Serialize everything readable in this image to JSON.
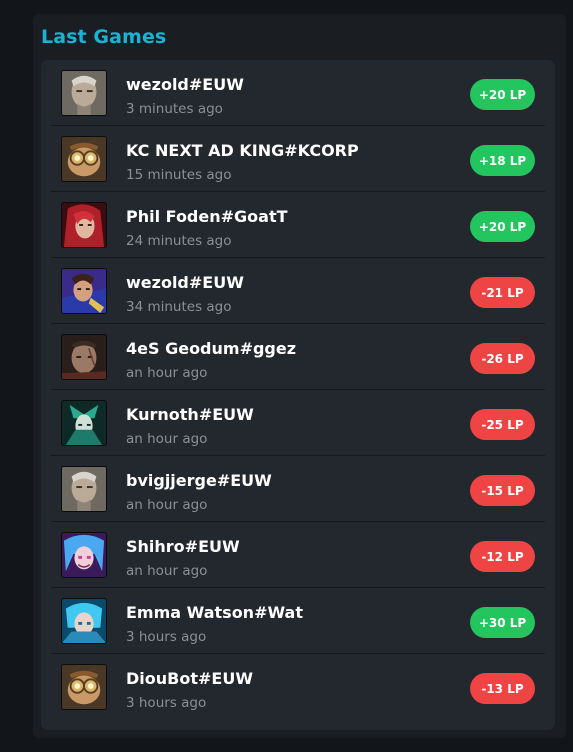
{
  "panel": {
    "title": "Last Games"
  },
  "colors": {
    "title": "#19b3d3",
    "win_badge": "#22c55e",
    "loss_badge": "#ef4444"
  },
  "games": [
    {
      "player": "wezold#EUW",
      "time": "3 minutes ago",
      "lp": "+20 LP",
      "result": "win",
      "champion_icon": "elder-warrior-portrait-icon"
    },
    {
      "player": "KC NEXT AD KING#KCORP",
      "time": "15 minutes ago",
      "lp": "+18 LP",
      "result": "win",
      "champion_icon": "goggled-yordle-portrait-icon"
    },
    {
      "player": "Phil Foden#GoatT",
      "time": "24 minutes ago",
      "lp": "+20 LP",
      "result": "win",
      "champion_icon": "red-haired-champion-portrait-icon"
    },
    {
      "player": "wezold#EUW",
      "time": "34 minutes ago",
      "lp": "-21 LP",
      "result": "loss",
      "champion_icon": "blue-armored-champion-portrait-icon"
    },
    {
      "player": "4eS Geodum#ggez",
      "time": "an hour ago",
      "lp": "-26 LP",
      "result": "loss",
      "champion_icon": "scarred-champion-portrait-icon"
    },
    {
      "player": "Kurnoth#EUW",
      "time": "an hour ago",
      "lp": "-25 LP",
      "result": "loss",
      "champion_icon": "green-sorceress-portrait-icon"
    },
    {
      "player": "bvigjjerge#EUW",
      "time": "an hour ago",
      "lp": "-15 LP",
      "result": "loss",
      "champion_icon": "elder-warrior-portrait-icon"
    },
    {
      "player": "Shihro#EUW",
      "time": "an hour ago",
      "lp": "-12 LP",
      "result": "loss",
      "champion_icon": "blue-haired-champion-portrait-icon"
    },
    {
      "player": "Emma Watson#Wat",
      "time": "3 hours ago",
      "lp": "+30 LP",
      "result": "win",
      "champion_icon": "cyan-fairy-portrait-icon"
    },
    {
      "player": "DiouBot#EUW",
      "time": "3 hours ago",
      "lp": "-13 LP",
      "result": "loss",
      "champion_icon": "goggled-yordle-portrait-icon"
    }
  ]
}
